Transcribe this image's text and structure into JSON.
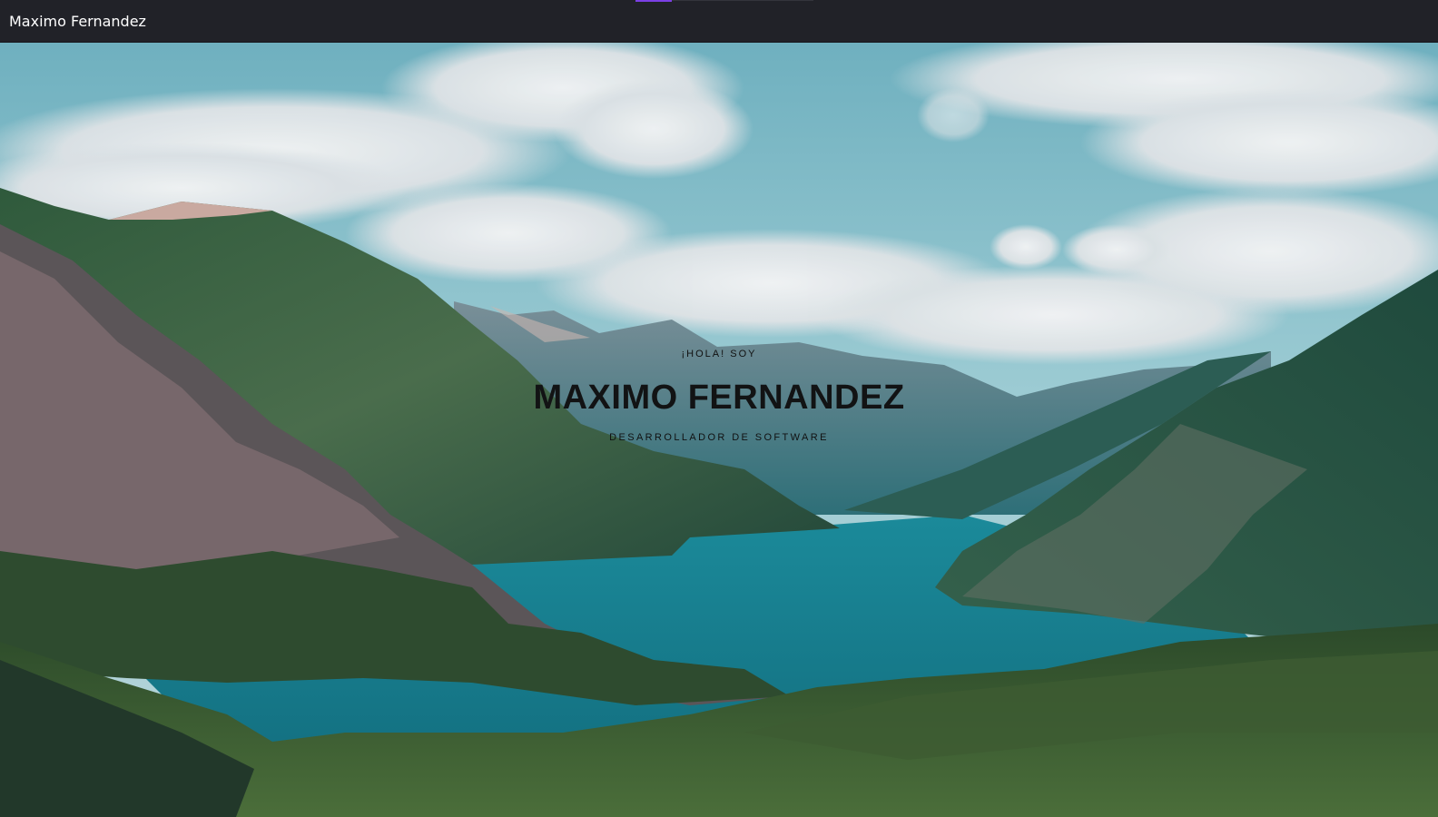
{
  "header": {
    "brand": "Maximo Fernandez",
    "accent_color": "#7b3fe4",
    "background": "#212228"
  },
  "hero": {
    "greeting": "¡HOLA! SOY",
    "name": "MAXIMO FERNANDEZ",
    "role": "DESARROLLADOR DE SOFTWARE",
    "background_image": "mountain-lake-landscape"
  }
}
